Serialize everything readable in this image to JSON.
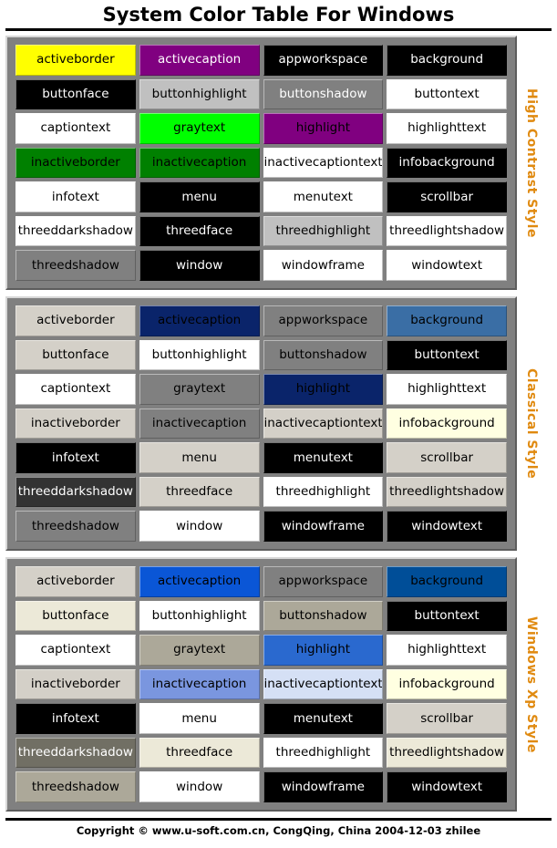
{
  "header": {
    "title": "System Color Table For Windows"
  },
  "footer": {
    "copyright": "Copyright © www.u-soft.com.cn, CongQing, China 2004-12-03 zhilee"
  },
  "accent_color": "#e08a10",
  "frame_color": "#808080",
  "sections": [
    {
      "label": "High Contrast Style",
      "rows": [
        [
          {
            "name": "activeborder",
            "bg": "#ffff00",
            "fg": "#000000"
          },
          {
            "name": "activecaption",
            "bg": "#800080",
            "fg": "#ffffff"
          },
          {
            "name": "appworkspace",
            "bg": "#000000",
            "fg": "#ffffff"
          },
          {
            "name": "background",
            "bg": "#000000",
            "fg": "#ffffff"
          }
        ],
        [
          {
            "name": "buttonface",
            "bg": "#000000",
            "fg": "#ffffff"
          },
          {
            "name": "buttonhighlight",
            "bg": "#c0c0c0",
            "fg": "#000000"
          },
          {
            "name": "buttonshadow",
            "bg": "#808080",
            "fg": "#ffffff"
          },
          {
            "name": "buttontext",
            "bg": "#ffffff",
            "fg": "#000000"
          }
        ],
        [
          {
            "name": "captiontext",
            "bg": "#ffffff",
            "fg": "#000000"
          },
          {
            "name": "graytext",
            "bg": "#00ff00",
            "fg": "#000000"
          },
          {
            "name": "highlight",
            "bg": "#800080",
            "fg": "#000000"
          },
          {
            "name": "highlighttext",
            "bg": "#ffffff",
            "fg": "#000000"
          }
        ],
        [
          {
            "name": "inactiveborder",
            "bg": "#008000",
            "fg": "#000000"
          },
          {
            "name": "inactivecaption",
            "bg": "#008000",
            "fg": "#000000"
          },
          {
            "name": "inactivecaptiontext",
            "bg": "#ffffff",
            "fg": "#000000"
          },
          {
            "name": "infobackground",
            "bg": "#000000",
            "fg": "#ffffff"
          }
        ],
        [
          {
            "name": "infotext",
            "bg": "#ffffff",
            "fg": "#000000"
          },
          {
            "name": "menu",
            "bg": "#000000",
            "fg": "#ffffff"
          },
          {
            "name": "menutext",
            "bg": "#ffffff",
            "fg": "#000000"
          },
          {
            "name": "scrollbar",
            "bg": "#000000",
            "fg": "#ffffff"
          }
        ],
        [
          {
            "name": "threeddarkshadow",
            "bg": "#ffffff",
            "fg": "#000000"
          },
          {
            "name": "threedface",
            "bg": "#000000",
            "fg": "#ffffff"
          },
          {
            "name": "threedhighlight",
            "bg": "#c0c0c0",
            "fg": "#000000"
          },
          {
            "name": "threedlightshadow",
            "bg": "#ffffff",
            "fg": "#000000"
          }
        ],
        [
          {
            "name": "threedshadow",
            "bg": "#808080",
            "fg": "#000000"
          },
          {
            "name": "window",
            "bg": "#000000",
            "fg": "#ffffff"
          },
          {
            "name": "windowframe",
            "bg": "#ffffff",
            "fg": "#000000"
          },
          {
            "name": "windowtext",
            "bg": "#ffffff",
            "fg": "#000000"
          }
        ]
      ]
    },
    {
      "label": "Classical Style",
      "rows": [
        [
          {
            "name": "activeborder",
            "bg": "#d4d0c8",
            "fg": "#000000"
          },
          {
            "name": "activecaption",
            "bg": "#0a246a",
            "fg": "#000000"
          },
          {
            "name": "appworkspace",
            "bg": "#808080",
            "fg": "#000000"
          },
          {
            "name": "background",
            "bg": "#3a6ea5",
            "fg": "#000000"
          }
        ],
        [
          {
            "name": "buttonface",
            "bg": "#d4d0c8",
            "fg": "#000000"
          },
          {
            "name": "buttonhighlight",
            "bg": "#ffffff",
            "fg": "#000000"
          },
          {
            "name": "buttonshadow",
            "bg": "#808080",
            "fg": "#000000"
          },
          {
            "name": "buttontext",
            "bg": "#000000",
            "fg": "#ffffff"
          }
        ],
        [
          {
            "name": "captiontext",
            "bg": "#ffffff",
            "fg": "#000000"
          },
          {
            "name": "graytext",
            "bg": "#808080",
            "fg": "#000000"
          },
          {
            "name": "highlight",
            "bg": "#0a246a",
            "fg": "#000000"
          },
          {
            "name": "highlighttext",
            "bg": "#ffffff",
            "fg": "#000000"
          }
        ],
        [
          {
            "name": "inactiveborder",
            "bg": "#d4d0c8",
            "fg": "#000000"
          },
          {
            "name": "inactivecaption",
            "bg": "#808080",
            "fg": "#000000"
          },
          {
            "name": "inactivecaptiontext",
            "bg": "#d4d0c8",
            "fg": "#000000"
          },
          {
            "name": "infobackground",
            "bg": "#ffffe1",
            "fg": "#000000"
          }
        ],
        [
          {
            "name": "infotext",
            "bg": "#000000",
            "fg": "#ffffff"
          },
          {
            "name": "menu",
            "bg": "#d4d0c8",
            "fg": "#000000"
          },
          {
            "name": "menutext",
            "bg": "#000000",
            "fg": "#ffffff"
          },
          {
            "name": "scrollbar",
            "bg": "#d4d0c8",
            "fg": "#000000"
          }
        ],
        [
          {
            "name": "threeddarkshadow",
            "bg": "#333333",
            "fg": "#ffffff"
          },
          {
            "name": "threedface",
            "bg": "#d4d0c8",
            "fg": "#000000"
          },
          {
            "name": "threedhighlight",
            "bg": "#ffffff",
            "fg": "#000000"
          },
          {
            "name": "threedlightshadow",
            "bg": "#d4d0c8",
            "fg": "#000000"
          }
        ],
        [
          {
            "name": "threedshadow",
            "bg": "#808080",
            "fg": "#000000"
          },
          {
            "name": "window",
            "bg": "#ffffff",
            "fg": "#000000"
          },
          {
            "name": "windowframe",
            "bg": "#000000",
            "fg": "#ffffff"
          },
          {
            "name": "windowtext",
            "bg": "#000000",
            "fg": "#ffffff"
          }
        ]
      ]
    },
    {
      "label": "Windows Xp Style",
      "rows": [
        [
          {
            "name": "activeborder",
            "bg": "#d4d0c8",
            "fg": "#000000"
          },
          {
            "name": "activecaption",
            "bg": "#0a56d6",
            "fg": "#000000"
          },
          {
            "name": "appworkspace",
            "bg": "#808080",
            "fg": "#000000"
          },
          {
            "name": "background",
            "bg": "#004e98",
            "fg": "#000000"
          }
        ],
        [
          {
            "name": "buttonface",
            "bg": "#ece9d8",
            "fg": "#000000"
          },
          {
            "name": "buttonhighlight",
            "bg": "#ffffff",
            "fg": "#000000"
          },
          {
            "name": "buttonshadow",
            "bg": "#aca899",
            "fg": "#000000"
          },
          {
            "name": "buttontext",
            "bg": "#000000",
            "fg": "#ffffff"
          }
        ],
        [
          {
            "name": "captiontext",
            "bg": "#ffffff",
            "fg": "#000000"
          },
          {
            "name": "graytext",
            "bg": "#aca899",
            "fg": "#000000"
          },
          {
            "name": "highlight",
            "bg": "#2a69cf",
            "fg": "#000000"
          },
          {
            "name": "highlighttext",
            "bg": "#ffffff",
            "fg": "#000000"
          }
        ],
        [
          {
            "name": "inactiveborder",
            "bg": "#d4d0c8",
            "fg": "#000000"
          },
          {
            "name": "inactivecaption",
            "bg": "#7a96df",
            "fg": "#000000"
          },
          {
            "name": "inactivecaptiontext",
            "bg": "#d5e0f5",
            "fg": "#000000"
          },
          {
            "name": "infobackground",
            "bg": "#ffffe1",
            "fg": "#000000"
          }
        ],
        [
          {
            "name": "infotext",
            "bg": "#000000",
            "fg": "#ffffff"
          },
          {
            "name": "menu",
            "bg": "#ffffff",
            "fg": "#000000"
          },
          {
            "name": "menutext",
            "bg": "#000000",
            "fg": "#ffffff"
          },
          {
            "name": "scrollbar",
            "bg": "#d4d0c8",
            "fg": "#000000"
          }
        ],
        [
          {
            "name": "threeddarkshadow",
            "bg": "#716f64",
            "fg": "#ffffff"
          },
          {
            "name": "threedface",
            "bg": "#ece9d8",
            "fg": "#000000"
          },
          {
            "name": "threedhighlight",
            "bg": "#ffffff",
            "fg": "#000000"
          },
          {
            "name": "threedlightshadow",
            "bg": "#ece9d8",
            "fg": "#000000"
          }
        ],
        [
          {
            "name": "threedshadow",
            "bg": "#aca899",
            "fg": "#000000"
          },
          {
            "name": "window",
            "bg": "#ffffff",
            "fg": "#000000"
          },
          {
            "name": "windowframe",
            "bg": "#000000",
            "fg": "#ffffff"
          },
          {
            "name": "windowtext",
            "bg": "#000000",
            "fg": "#ffffff"
          }
        ]
      ]
    }
  ]
}
